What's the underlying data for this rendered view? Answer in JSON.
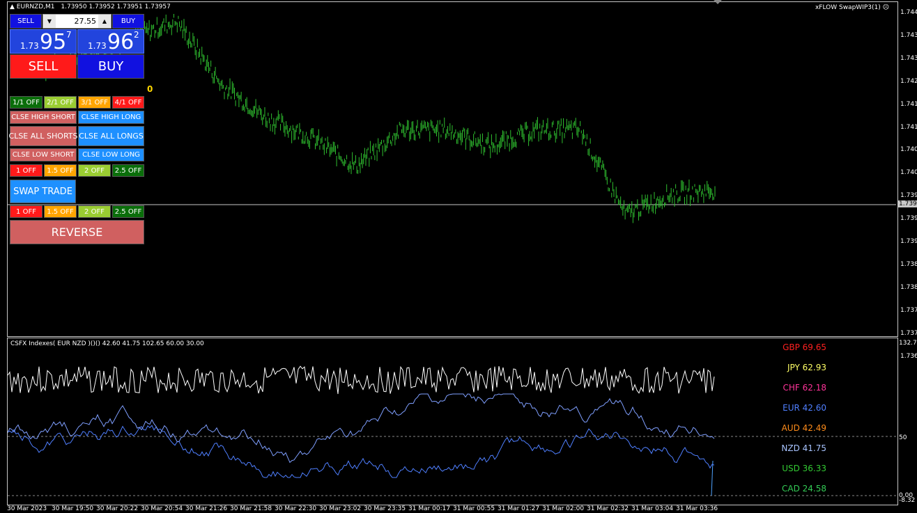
{
  "header": {
    "symbol": "EURNZD,M1",
    "prices": "1.73950 1.73952 1.73951 1.73957",
    "indicator_name": "xFLOW SwapWIP3(1)"
  },
  "panel": {
    "sell_small": "SELL",
    "buy_small": "BUY",
    "lot_value": "27.55",
    "sell_price": {
      "pre": "1.73",
      "big": "95",
      "sup": "7"
    },
    "buy_price": {
      "pre": "1.73",
      "big": "96",
      "sup": "2"
    },
    "sell_big": "SELL",
    "buy_big": "BUY",
    "spread": "0",
    "row1": [
      "1/1 OFF",
      "2/1 OFF",
      "3/1 OFF",
      "4/1 OFF"
    ],
    "close_high_short": "CLSE HIGH SHORT",
    "close_high_long": "CLSE HIGH LONG",
    "close_all_shorts": "CLSE ALL SHORTS",
    "close_all_longs": "CLSE ALL LONGS",
    "close_low_short": "CLSE LOW SHORT",
    "close_low_long": "CLSE LOW LONG",
    "row2": [
      "1 OFF",
      "1.5 OFF",
      "2 OFF",
      "2.5 OFF"
    ],
    "swap_trade": "SWAP TRADE",
    "row3": [
      "1 OFF",
      "1.5 OFF",
      "2  OFF",
      "2.5 OFF"
    ],
    "reverse": "REVERSE"
  },
  "price_axis": {
    "labels": [
      "1.744",
      "1.743",
      "1.743",
      "1.742",
      "1.741",
      "1.741",
      "1.740",
      "1.740",
      "1.739",
      "1.739",
      "1.739",
      "1.738",
      "1.738",
      "1.737",
      "1.737",
      "1.736"
    ],
    "current": "1.739"
  },
  "subwindow": {
    "title": "CSFX Indexes( EUR NZD )()() 42.60 41.75 102.65 60.00 30.00",
    "axis_top": "132.73",
    "axis_mid": "50",
    "axis_bottom": "0.00",
    "axis_bottom2": "-8.32",
    "legend": [
      {
        "label": "GBP 69.65",
        "color": "#ff2020"
      },
      {
        "label": "JPY 62.93",
        "color": "#ffff66"
      },
      {
        "label": "CHF 62.18",
        "color": "#ff3399"
      },
      {
        "label": "EUR 42.60",
        "color": "#4f7fff"
      },
      {
        "label": "AUD 42.49",
        "color": "#ff8c1a"
      },
      {
        "label": "NZD 41.75",
        "color": "#a8c4ff"
      },
      {
        "label": "USD 36.33",
        "color": "#33cc33"
      },
      {
        "label": "CAD 24.58",
        "color": "#33cc55"
      }
    ]
  },
  "time_axis": [
    "30 Mar 2023",
    "30 Mar 19:50",
    "30 Mar 20:22",
    "30 Mar 20:54",
    "30 Mar 21:26",
    "30 Mar 21:58",
    "30 Mar 22:30",
    "30 Mar 23:02",
    "30 Mar 23:35",
    "31 Mar 00:17",
    "31 Mar 00:55",
    "31 Mar 01:27",
    "31 Mar 02:00",
    "31 Mar 02:32",
    "31 Mar 03:04",
    "31 Mar 03:36"
  ],
  "chart_data": {
    "type": "line",
    "symbol": "EURNZD",
    "timeframe": "M1",
    "ylim": [
      1.736,
      1.744
    ],
    "current_price": 1.7395,
    "x": [
      "30 Mar 2023",
      "30 Mar 19:50",
      "30 Mar 20:22",
      "30 Mar 20:54",
      "30 Mar 21:26",
      "30 Mar 21:58",
      "30 Mar 22:30",
      "30 Mar 23:02",
      "30 Mar 23:35",
      "31 Mar 00:17",
      "31 Mar 00:55",
      "31 Mar 01:27",
      "31 Mar 02:00",
      "31 Mar 02:32",
      "31 Mar 03:04",
      "31 Mar 03:36"
    ],
    "series": [
      {
        "name": "EURNZD",
        "values": [
          1.7425,
          1.7428,
          1.7433,
          1.7437,
          1.7421,
          1.7413,
          1.7408,
          1.7401,
          1.741,
          1.741,
          1.7406,
          1.741,
          1.741,
          1.7389,
          1.7394,
          1.7395
        ]
      }
    ]
  }
}
